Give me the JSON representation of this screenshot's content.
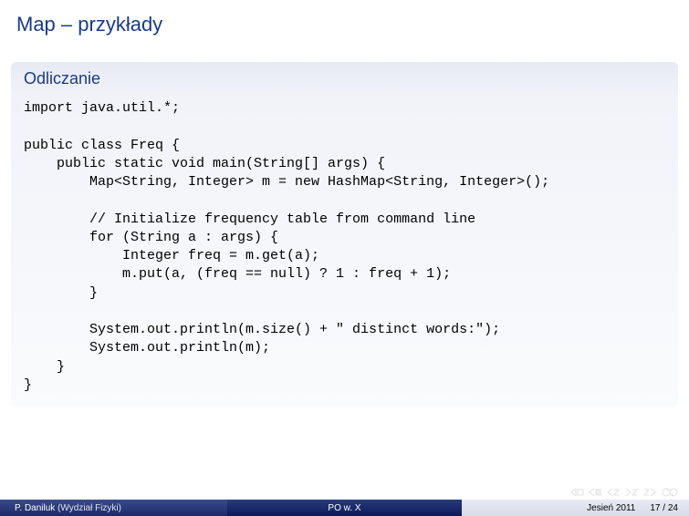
{
  "title": "Map – przykłady",
  "block": {
    "title": "Odliczanie",
    "code": "import java.util.*;\n\npublic class Freq {\n    public static void main(String[] args) {\n        Map<String, Integer> m = new HashMap<String, Integer>();\n\n        // Initialize frequency table from command line\n        for (String a : args) {\n            Integer freq = m.get(a);\n            m.put(a, (freq == null) ? 1 : freq + 1);\n        }\n\n        System.out.println(m.size() + \" distinct words:\");\n        System.out.println(m);\n    }\n}"
  },
  "footer": {
    "author": "P. Daniluk",
    "affiliation": "(Wydział Fizyki)",
    "center": "PO w. X",
    "date": "Jesień 2011",
    "page_current": "17",
    "page_sep": " / ",
    "page_total": "24"
  }
}
